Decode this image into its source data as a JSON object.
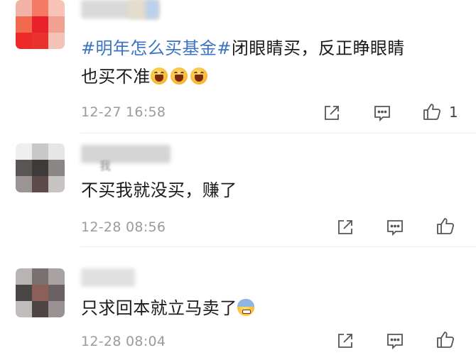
{
  "comments": [
    {
      "text_topic": "#明年怎么买基金#",
      "text_rest_line1": "闭眼睛买，反正睁眼睛",
      "text_line2": "也买不准",
      "emojis": [
        "laughing-emoji",
        "laughing-emoji",
        "laughing-emoji"
      ],
      "time": "12-27 16:58",
      "like_count": "1"
    },
    {
      "author_partial": "我",
      "text": "不买我就没买，赚了",
      "time": "12-28 08:56",
      "like_count": ""
    },
    {
      "text": "只求回本就立马卖了",
      "emojis": [
        "nervous-emoji"
      ],
      "time": "12-28 08:04",
      "like_count": ""
    }
  ],
  "colors": {
    "topic": "#3b74c2",
    "meta": "#9b9b9b",
    "divider": "#ececec"
  },
  "icons": [
    "share-icon",
    "comment-icon",
    "like-icon"
  ]
}
